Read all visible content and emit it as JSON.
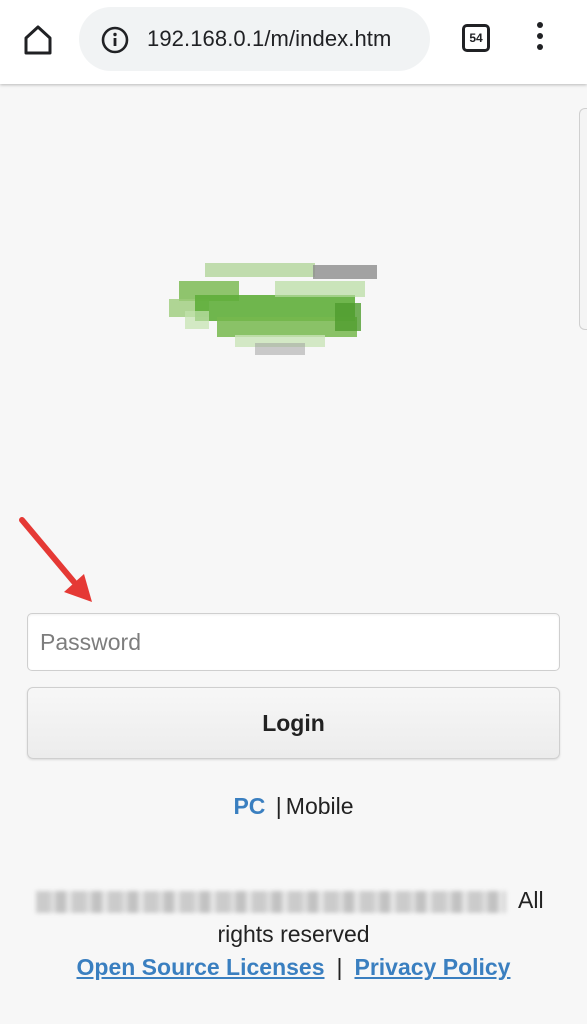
{
  "browser": {
    "url": "192.168.0.1/m/index.htm",
    "tab_count": "54"
  },
  "login_form": {
    "password_placeholder": "Password",
    "login_label": "Login"
  },
  "mode_switch": {
    "pc_label": "PC",
    "separator": "|",
    "mobile_label": "Mobile"
  },
  "footer": {
    "all_text": "All",
    "rights_text": "rights reserved",
    "open_source_label": "Open Source Licenses",
    "separator": "|",
    "privacy_label": "Privacy Policy"
  },
  "colors": {
    "link": "#3a7fc0",
    "arrow": "#e53935",
    "logo_green": "#5fae3a"
  }
}
